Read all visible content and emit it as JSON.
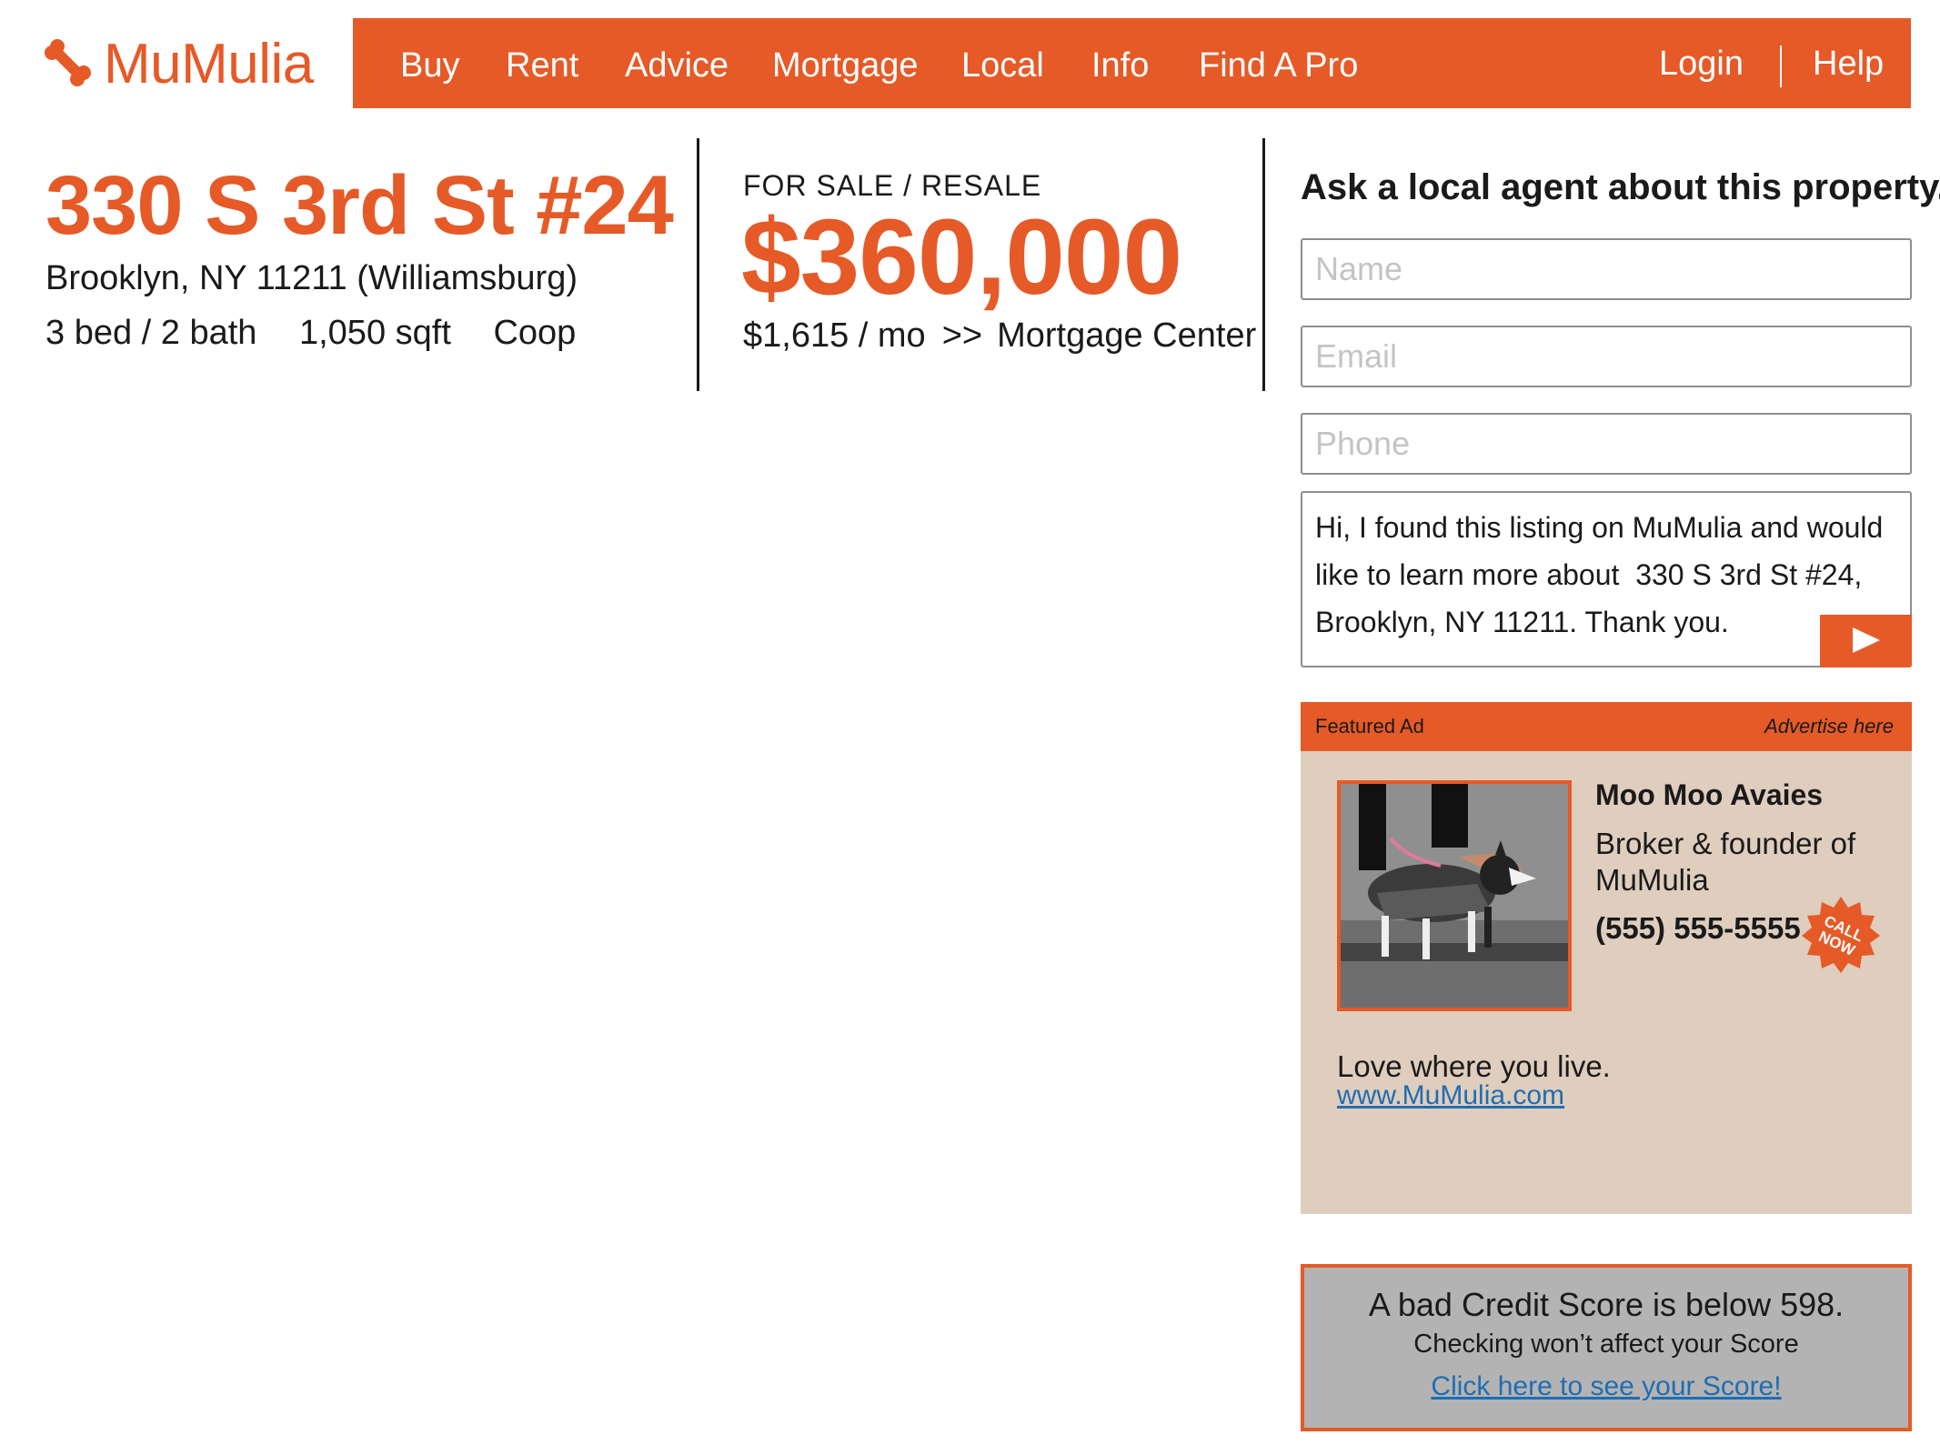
{
  "brand": {
    "name": "MuMulia",
    "logo_icon": "bone-icon",
    "accent_color": "#e55a27"
  },
  "nav": {
    "items": [
      "Buy",
      "Rent",
      "Advice",
      "Mortgage",
      "Local",
      "Info",
      "Find A Pro"
    ],
    "login": "Login",
    "separator": "|",
    "help": "Help"
  },
  "listing": {
    "address": "330 S 3rd St #24",
    "city_line": "Brooklyn, NY 11211 (Williamsburg)",
    "beds_baths": "3 bed / 2 bath",
    "sqft": "1,050 sqft",
    "type": "Coop"
  },
  "pricing": {
    "status": "FOR SALE / RESALE",
    "price": "$360,000",
    "monthly": "$1,615 / mo",
    "arrows": ">>",
    "mortgage_link": "Mortgage Center"
  },
  "contact_form": {
    "heading": "Ask a local agent about this property.",
    "name_placeholder": "Name",
    "email_placeholder": "Email",
    "phone_placeholder": "Phone",
    "message": "Hi, I found this listing on MuMulia and would like to learn more about  330 S 3rd St #24, Brooklyn, NY 11211. Thank you.",
    "send_icon": "play-arrow-icon"
  },
  "featured_ad": {
    "label": "Featured Ad",
    "advertise_link": "Advertise here",
    "agent_name": "Moo Moo Avaies",
    "agent_title": "Broker & founder of MuMulia",
    "phone": "(555) 555-5555",
    "badge_line1": "CALL",
    "badge_line2": "NOW",
    "tagline": "Love where you live.",
    "website": "www.MuMulia.com",
    "background_color": "#dfcdbd"
  },
  "credit_ad": {
    "headline": "A bad Credit Score is below 598.",
    "subline": "Checking won’t affect your Score",
    "link": "Click here to see your Score!"
  }
}
